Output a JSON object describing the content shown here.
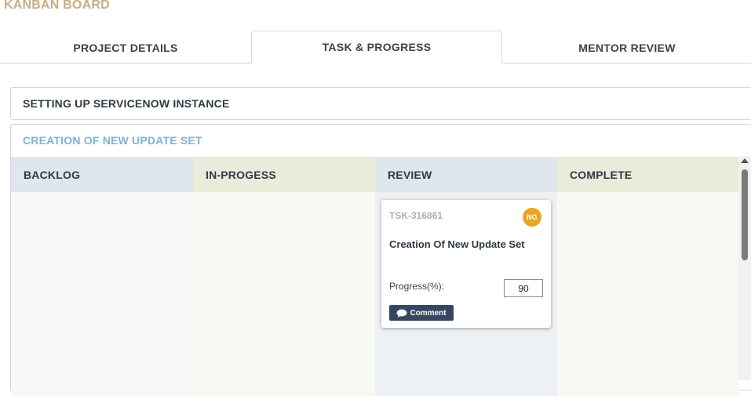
{
  "app": {
    "title": "KANBAN BOARD"
  },
  "tabs": [
    {
      "label": "PROJECT DETAILS"
    },
    {
      "label": "TASK & PROGRESS",
      "active": true
    },
    {
      "label": "MENTOR REVIEW"
    }
  ],
  "sections": [
    {
      "title": "SETTING UP SERVICENOW INSTANCE",
      "expanded": false
    },
    {
      "title": "CREATION OF NEW UPDATE SET",
      "expanded": true
    }
  ],
  "board": {
    "columns": [
      {
        "label": "BACKLOG"
      },
      {
        "label": "IN-PROGESS"
      },
      {
        "label": "REVIEW"
      },
      {
        "label": "COMPLETE"
      }
    ],
    "card": {
      "id": "TSK-316861",
      "assignee_initials": "NG",
      "title": "Creation Of New Update Set",
      "progress_label": "Progress(%):",
      "progress_value": "90",
      "comment_label": "Comment",
      "column": "REVIEW"
    }
  },
  "colors": {
    "title": "#c8ad85",
    "section_active": "#7fb2d4",
    "avatar": "#e8a623",
    "comment_button": "#35475f"
  },
  "icons": {
    "comment": "speech-bubble-icon"
  }
}
